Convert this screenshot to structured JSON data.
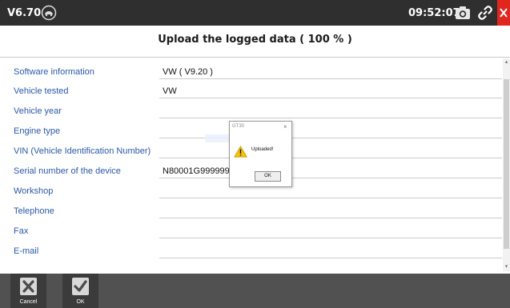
{
  "topbar": {
    "version": "V6.70",
    "logo_icon": "vw-car-logo-icon",
    "time": "09:52:07",
    "icons": [
      "camera-icon",
      "link-icon",
      "close-icon"
    ]
  },
  "title": "Upload the logged data ( 100 % )",
  "rows": [
    {
      "label": "Software information",
      "value": "VW  ( V9.20 )"
    },
    {
      "label": "Vehicle tested",
      "value": "VW"
    },
    {
      "label": "Vehicle year",
      "value": ""
    },
    {
      "label": "Engine type",
      "value": ""
    },
    {
      "label": "VIN (Vehicle Identification Number)",
      "value": ""
    },
    {
      "label": "Serial number of the device",
      "value": "N80001G999999"
    },
    {
      "label": "Workshop",
      "value": ""
    },
    {
      "label": "Telephone",
      "value": ""
    },
    {
      "label": "Fax",
      "value": ""
    },
    {
      "label": "E-mail",
      "value": ""
    }
  ],
  "dialog": {
    "title": "GT30",
    "message": "Uploaded!",
    "ok_label": "OK",
    "icon": "warning-icon"
  },
  "bottombar": {
    "cancel_label": "Cancel",
    "ok_label": "OK"
  },
  "colors": {
    "topbar": "#2f2f2f",
    "close": "#e0261e",
    "label": "#2b58a6",
    "bottombar": "#515151"
  }
}
